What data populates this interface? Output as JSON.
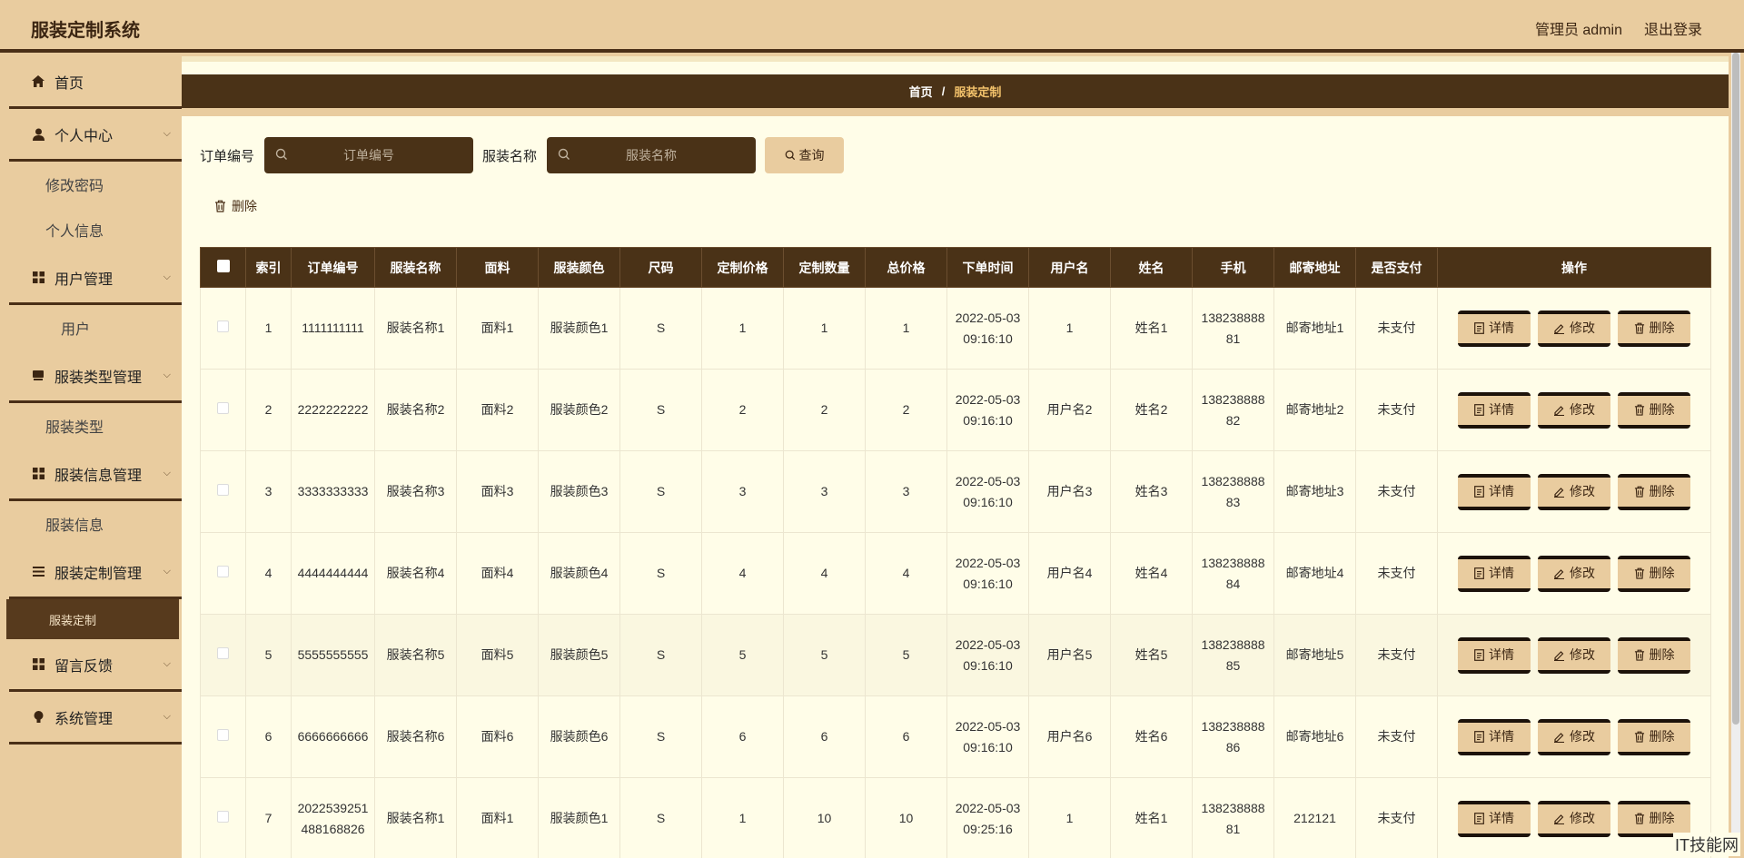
{
  "app": {
    "title": "服装定制系统",
    "user_label": "管理员 admin",
    "logout_label": "退出登录"
  },
  "sidebar": {
    "home": "首页",
    "personal_center": "个人中心",
    "change_password": "修改密码",
    "personal_info": "个人信息",
    "user_mgmt": "用户管理",
    "user": "用户",
    "type_mgmt": "服装类型管理",
    "type": "服装类型",
    "info_mgmt": "服装信息管理",
    "info": "服装信息",
    "custom_mgmt": "服装定制管理",
    "custom": "服装定制",
    "feedback": "留言反馈",
    "system_mgmt": "系统管理"
  },
  "breadcrumb": {
    "home": "首页",
    "sep": "/",
    "current": "服装定制"
  },
  "search": {
    "order_label": "订单编号",
    "order_placeholder": "订单编号",
    "name_label": "服装名称",
    "name_placeholder": "服装名称",
    "query_label": "查询",
    "delete_label": "删除"
  },
  "table": {
    "headers": [
      "索引",
      "订单编号",
      "服装名称",
      "面料",
      "服装颜色",
      "尺码",
      "定制价格",
      "定制数量",
      "总价格",
      "下单时间",
      "用户名",
      "姓名",
      "手机",
      "邮寄地址",
      "是否支付",
      "操作"
    ],
    "actions": {
      "detail": "详情",
      "edit": "修改",
      "delete": "删除"
    },
    "rows": [
      [
        "1",
        "1111111111",
        "服装名称1",
        "面料1",
        "服装颜色1",
        "S",
        "1",
        "1",
        "1",
        "2022-05-03 09:16:10",
        "1",
        "姓名1",
        "13823888881",
        "邮寄地址1",
        "未支付"
      ],
      [
        "2",
        "2222222222",
        "服装名称2",
        "面料2",
        "服装颜色2",
        "S",
        "2",
        "2",
        "2",
        "2022-05-03 09:16:10",
        "用户名2",
        "姓名2",
        "13823888882",
        "邮寄地址2",
        "未支付"
      ],
      [
        "3",
        "3333333333",
        "服装名称3",
        "面料3",
        "服装颜色3",
        "S",
        "3",
        "3",
        "3",
        "2022-05-03 09:16:10",
        "用户名3",
        "姓名3",
        "13823888883",
        "邮寄地址3",
        "未支付"
      ],
      [
        "4",
        "4444444444",
        "服装名称4",
        "面料4",
        "服装颜色4",
        "S",
        "4",
        "4",
        "4",
        "2022-05-03 09:16:10",
        "用户名4",
        "姓名4",
        "13823888884",
        "邮寄地址4",
        "未支付"
      ],
      [
        "5",
        "5555555555",
        "服装名称5",
        "面料5",
        "服装颜色5",
        "S",
        "5",
        "5",
        "5",
        "2022-05-03 09:16:10",
        "用户名5",
        "姓名5",
        "13823888885",
        "邮寄地址5",
        "未支付"
      ],
      [
        "6",
        "6666666666",
        "服装名称6",
        "面料6",
        "服装颜色6",
        "S",
        "6",
        "6",
        "6",
        "2022-05-03 09:16:10",
        "用户名6",
        "姓名6",
        "13823888886",
        "邮寄地址6",
        "未支付"
      ],
      [
        "7",
        "2022539251488168826",
        "服装名称1",
        "面料1",
        "服装颜色1",
        "S",
        "1",
        "10",
        "10",
        "2022-05-03 09:25:16",
        "1",
        "姓名1",
        "13823888881",
        "212121",
        "未支付"
      ]
    ]
  },
  "watermark": "IT技能网",
  "colors": {
    "dark_brown": "#4a3217",
    "tan": "#e9cc9f",
    "cream": "#fffde8",
    "breadcrumb_current": "#f3c26b"
  }
}
